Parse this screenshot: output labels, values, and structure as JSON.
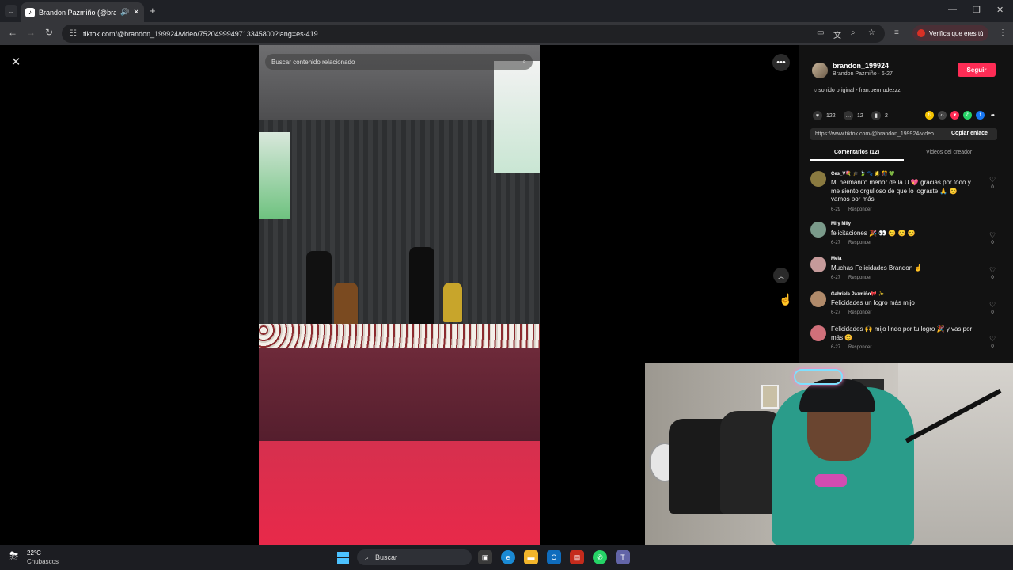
{
  "browser": {
    "tab_title": "Brandon Pazmiño (@brand",
    "tab_icon": "♪",
    "url": "tiktok.com/@brandon_199924/video/7520499949713345800?lang=es-419",
    "profile_label": "Verifica que eres tú"
  },
  "video": {
    "search_placeholder": "Buscar contenido relacionado"
  },
  "creator": {
    "username": "brandon_199924",
    "subtitle": "Brandon Pazmiño · 6-27",
    "follow_label": "Seguir",
    "music": "♫  sonido original - fran.bermudezzz",
    "likes": "122",
    "comments": "12",
    "saves": "2",
    "link": "https://www.tiktok.com/@brandon_199924/video...",
    "copy_label": "Copiar enlace"
  },
  "tabs": {
    "comments": "Comentarios (12)",
    "videos": "Videos del creador"
  },
  "comments": [
    {
      "name": "Ces_V💐 🎓 🍃 🐾 🌟 🎊 💚",
      "text": "Mi hermanito menor de la U 💖 gracias por todo y me siento orgulloso de que lo lograste 🙏 😊 vamos por más",
      "date": "6-29",
      "reply": "Responder",
      "likes": "0",
      "color": "#8a7a40"
    },
    {
      "name": "Mily Mily",
      "text": "felicitaciones 🎉 👀 😊 😊 😊",
      "date": "6-27",
      "reply": "Responder",
      "likes": "0",
      "color": "#7a9a8a"
    },
    {
      "name": "Mela",
      "text": "Muchas Felicidades Brandon ☝",
      "date": "6-27",
      "reply": "Responder",
      "likes": "0",
      "color": "#c59a9a"
    },
    {
      "name": "Gabriela Pazmiño🎀 ✨",
      "text": "Felicidades un logro más mijo",
      "date": "6-27",
      "reply": "Responder",
      "likes": "0",
      "color": "#b08a6a"
    },
    {
      "name": "",
      "text": "Felicidades 🙌 mijo lindo por tu logro 🎉 y vas por más 😊",
      "date": "6-27",
      "reply": "Responder",
      "likes": "0",
      "color": "#d0707a"
    }
  ],
  "taskbar": {
    "temp": "22°C",
    "condition": "Chubascos",
    "search_label": "Buscar"
  }
}
